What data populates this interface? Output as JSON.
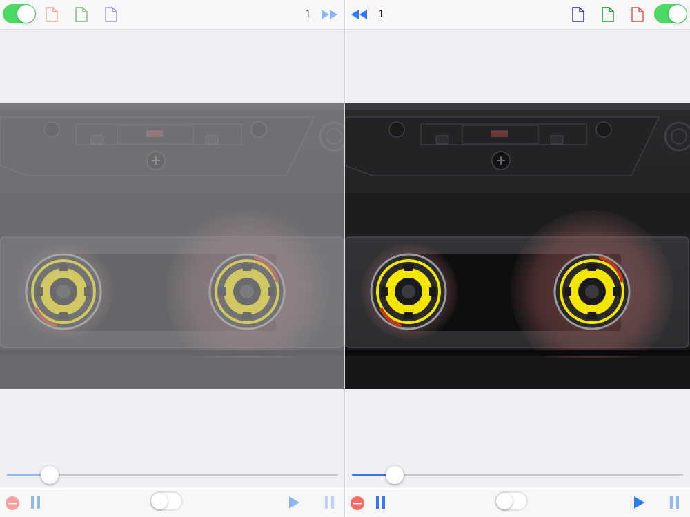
{
  "left_deck": {
    "mode_toggle": {
      "state": "on"
    },
    "file_icons": [
      "red-document-icon",
      "green-document-icon",
      "purple-document-icon"
    ],
    "page_number": "1",
    "nav_icon": "fast-forward-icon",
    "position_progress": 0.13,
    "controls": [
      "remove-icon",
      "pause-icon",
      "play-icon",
      "pause-icon"
    ],
    "link_toggle": {
      "state": "off"
    },
    "dimmed": true
  },
  "right_deck": {
    "mode_toggle": {
      "state": "on"
    },
    "file_icons": [
      "blue-document-icon",
      "green-document-icon",
      "red-document-icon"
    ],
    "page_number": "1",
    "nav_icon": "rewind-icon",
    "position_progress": 0.13,
    "controls": [
      "remove-icon",
      "pause-icon",
      "play-icon",
      "pause-icon"
    ],
    "link_toggle": {
      "state": "off"
    },
    "dimmed": false
  },
  "colors": {
    "toggle_on": "#4cd964",
    "accent_blue": "#2e7cf6",
    "remove_red": "#ff3b30",
    "reel_yellow": "#f5e600",
    "cassette_body": "#1a1a1c"
  }
}
